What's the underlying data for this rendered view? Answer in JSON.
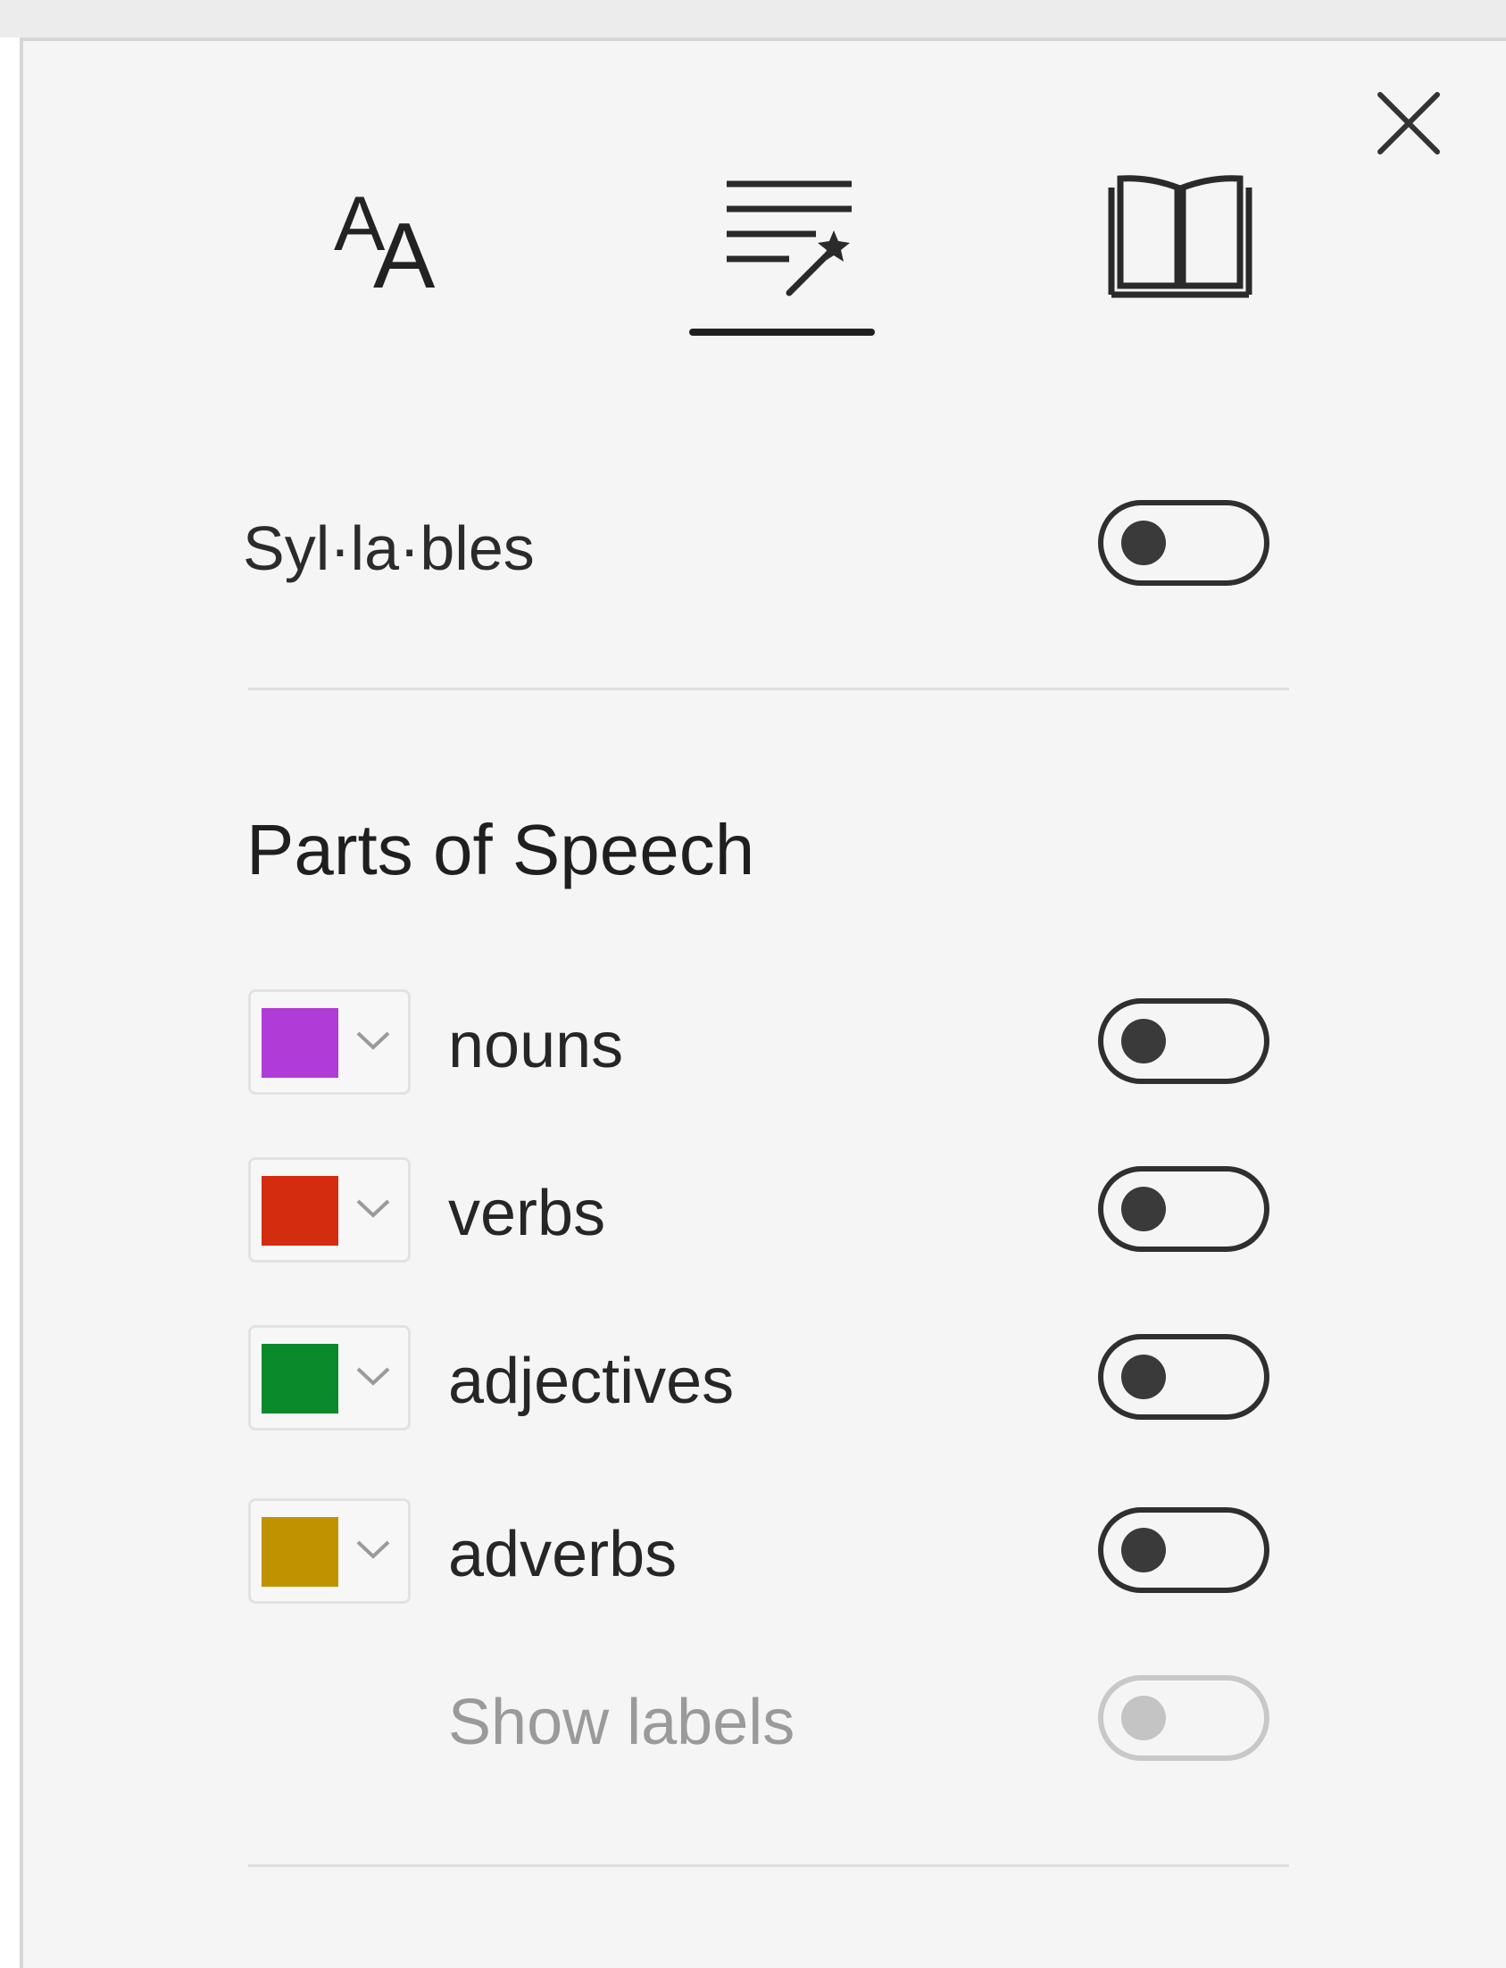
{
  "panel": {
    "tabs": [
      {
        "name": "text-preferences",
        "icon": "text-size-icon"
      },
      {
        "name": "grammar-options",
        "icon": "grammar-wand-icon",
        "selected": true
      },
      {
        "name": "reading-preferences",
        "icon": "book-icon"
      }
    ]
  },
  "syllables": {
    "label": "Syl·la·bles",
    "on": false
  },
  "parts_of_speech": {
    "title": "Parts of Speech",
    "items": [
      {
        "label": "nouns",
        "color": "#b03bd6",
        "on": false
      },
      {
        "label": "verbs",
        "color": "#d42c0f",
        "on": false
      },
      {
        "label": "adjectives",
        "color": "#0a8a2a",
        "on": false
      },
      {
        "label": "adverbs",
        "color": "#c09200",
        "on": false
      }
    ],
    "show_labels": {
      "label": "Show labels",
      "on": false,
      "disabled": true
    }
  }
}
